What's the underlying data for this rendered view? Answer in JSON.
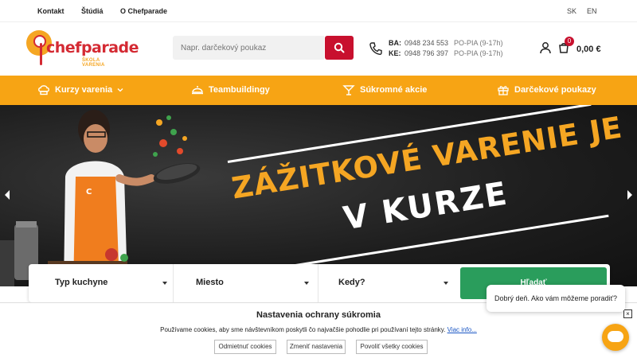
{
  "topbar": {
    "links": [
      "Kontakt",
      "Štúdiá",
      "O Chefparade"
    ],
    "languages": [
      "SK",
      "EN"
    ]
  },
  "logo": {
    "name": "chefparade",
    "sub": "ŠKOLA VARENIA"
  },
  "search": {
    "placeholder": "Napr. darčekový poukaz"
  },
  "phones": [
    {
      "city": "BA:",
      "number": "0948 234 553",
      "hours": "PO-PIA (9-17h)"
    },
    {
      "city": "KE:",
      "number": "0948 796 397",
      "hours": "PO-PIA (9-17h)"
    }
  ],
  "cart": {
    "count": "0",
    "total": "0,00 €"
  },
  "nav": [
    {
      "label": "Kurzy varenia",
      "icon": "chef-hat-icon"
    },
    {
      "label": "Teambuildingy",
      "icon": "cloche-icon"
    },
    {
      "label": "Súkromné akcie",
      "icon": "cocktail-icon"
    },
    {
      "label": "Darčekové poukazy",
      "icon": "gift-icon"
    }
  ],
  "hero": {
    "line1": "ZÁŽITKOVÉ VARENIE JE",
    "line2": "V KURZE"
  },
  "filter": {
    "cuisine": "Typ kuchyne",
    "place": "Miesto",
    "when": "Kedy?",
    "button": "Hľadať"
  },
  "cookie": {
    "title": "Nastavenia ochrany súkromia",
    "text": "Používame cookies, aby sme návštevníkom poskytli čo najvačšie pohodlie pri používaní tejto stránky.",
    "link": "Viac info...",
    "buttons": [
      "Odmietnuť cookies",
      "Zmeniť nastavenia",
      "Povoliť všetky cookies"
    ]
  },
  "chat": {
    "message": "Dobrý deň. Ako vám môžeme poradiť?"
  },
  "colors": {
    "orange": "#f7a414",
    "red": "#c8102e",
    "green": "#2a9d5c"
  }
}
